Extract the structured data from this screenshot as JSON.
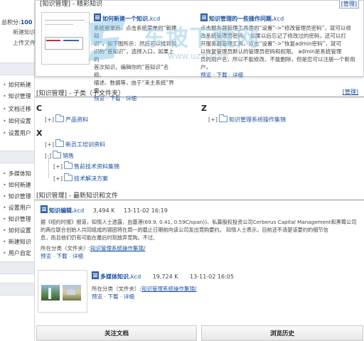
{
  "sidebar": {
    "points_label": "总积分:",
    "points_value": "100",
    "sub1": "新建知识",
    "sub2": "上传文件",
    "group1": [
      "如何新建",
      "知识管理",
      "文档迁移",
      "如何设置",
      "设置用户"
    ],
    "group2": [
      "多媒体知",
      "如何新建",
      "知识管理",
      "设置用户",
      "知识管理",
      "如何设置",
      "新建知识",
      "用户自定"
    ]
  },
  "top": {
    "title": "[知识管理] - 精彩知识",
    "manage": "[管理]",
    "card1": {
      "title": "如何新建一个知识.",
      "ext": "kcd",
      "desc": "系统登录后，点击系统菜单的“新建知识”，如下图所示：然后可以找到知识的“首知识”，选择入口，如果上的首次知识，编辑你的“首知识”名称、描述、数据等，由于“来主系统”界面，",
      "desc_lines": [
        "系统登录后，点击系统菜单的“新建知",
        "识”，如下图所示：然后可以找到知",
        "识的“首知识”，选择入口，如果上的",
        "首次知识，编辑你的“首知识”名称、",
        "描述、数据等，由于“来主系统”界面，"
      ],
      "preview": "预览",
      "download": "下载",
      "detail": "详细"
    },
    "card2": {
      "title": "知识管理的一些操作问题.",
      "ext": "kcd",
      "desc_lines": [
        "点击服务器管理工具里的“设置”->“修改管理员密码”，就可以修",
        "改系统管理员密码。 如果以后忘记了修改过的密码，还可以打",
        "开服务器管理工具，点击“设置”->“恢复admin密码”，就可",
        "以恢复管理员默认的管理员密码和权限。 admin是系统管理",
        "员的用户名，所以不能修改、不能删除，但是您可以注册一个新用",
        "户，"
      ],
      "preview": "预览",
      "download": "下载",
      "detail": "详细"
    }
  },
  "subclass": {
    "title": "[知识管理] - 子类（子文件夹）",
    "manage": "[管理]",
    "groups": [
      {
        "letter": "C",
        "items": [
          "产品资料"
        ]
      },
      {
        "letter": "Z",
        "items": [
          "知识管理系统操作集锦"
        ]
      },
      {
        "letter": "X",
        "items": [
          "新员工培训资料",
          "销售",
          "售前技术资料集锦",
          "技术解决方案"
        ]
      }
    ]
  },
  "latest": {
    "title": "[知识管理] - 最新知识和文件",
    "item1": {
      "title": "知识编辑.",
      "ext": "kcd",
      "size": "3,494 K",
      "date": "13-11-02 16:19",
      "desc_lines": [
        "据《纽约时报》报道，知情人士透露，由基港(69.9, 0.41, 0.59C/span))、私募股权投资公司Cerberus Capital Management和黑莓公司",
        "的两位联合创始人共同组成的银团将在周一的截止日期前向该公司发出竞购要约。      知情人士表示，目前还不清楚该要约的细节信",
        "息，而且他们仍有可能在最后时刻放弃竞购。不过,"
      ],
      "category_label": "所在分类（文件夹）:",
      "category": "知识管理系统操作集锦/",
      "preview": "预览",
      "download": "下载",
      "detail": "详细"
    },
    "item2": {
      "title": "多媒体知识.",
      "ext": "kcd",
      "size": "19,724 K",
      "date": "13-11-02 16:05",
      "category_label": "所在分类（文件夹）:",
      "category": "知识管理系统操作集锦/",
      "preview": "预览",
      "download": "下载",
      "detail": "详细"
    }
  },
  "buttons": {
    "follow": "关注文档",
    "history": "浏览历史"
  },
  "watermark": {
    "text": "东坡下载网",
    "url": "www.uzzf.com"
  }
}
